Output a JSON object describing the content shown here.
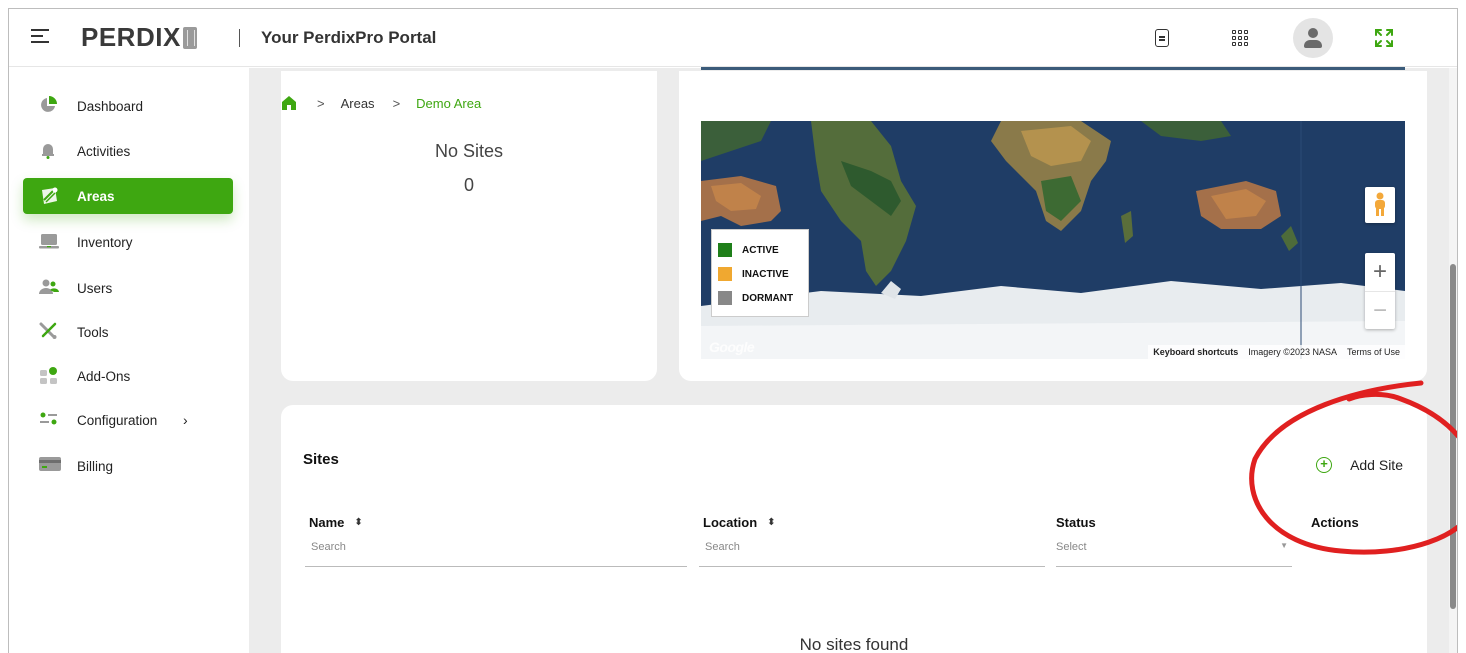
{
  "header": {
    "brand": "PERDIX",
    "portal_title": "Your PerdixPro Portal"
  },
  "sidebar": {
    "items": [
      {
        "label": "Dashboard",
        "icon": "pie-chart-icon"
      },
      {
        "label": "Activities",
        "icon": "bell-icon"
      },
      {
        "label": "Areas",
        "icon": "area-map-icon",
        "active": true
      },
      {
        "label": "Inventory",
        "icon": "laptop-icon"
      },
      {
        "label": "Users",
        "icon": "users-icon"
      },
      {
        "label": "Tools",
        "icon": "tools-icon"
      },
      {
        "label": "Add-Ons",
        "icon": "add-ons-icon"
      },
      {
        "label": "Configuration",
        "icon": "sliders-icon",
        "chevron": "›"
      },
      {
        "label": "Billing",
        "icon": "credit-card-icon"
      }
    ]
  },
  "breadcrumb": {
    "items": [
      "Areas",
      "Demo Area"
    ]
  },
  "summary": {
    "title": "No Sites",
    "count": "0"
  },
  "map": {
    "legend": [
      {
        "label": "ACTIVE",
        "color": "#1f7f1a"
      },
      {
        "label": "INACTIVE",
        "color": "#f0a830"
      },
      {
        "label": "DORMANT",
        "color": "#888888"
      }
    ],
    "google_label": "Google",
    "keyboard_shortcuts": "Keyboard shortcuts",
    "imagery": "Imagery ©2023 NASA",
    "terms": "Terms of Use",
    "zoom_in": "+",
    "zoom_out": "−"
  },
  "sites_table": {
    "heading": "Sites",
    "add_label": "Add Site",
    "columns": {
      "name": "Name",
      "location": "Location",
      "status": "Status",
      "actions": "Actions"
    },
    "filters": {
      "name_placeholder": "Search",
      "location_placeholder": "Search",
      "status_placeholder": "Select"
    },
    "empty": "No sites found"
  },
  "colors": {
    "accent": "#3ea711",
    "annotation": "#e02020"
  }
}
